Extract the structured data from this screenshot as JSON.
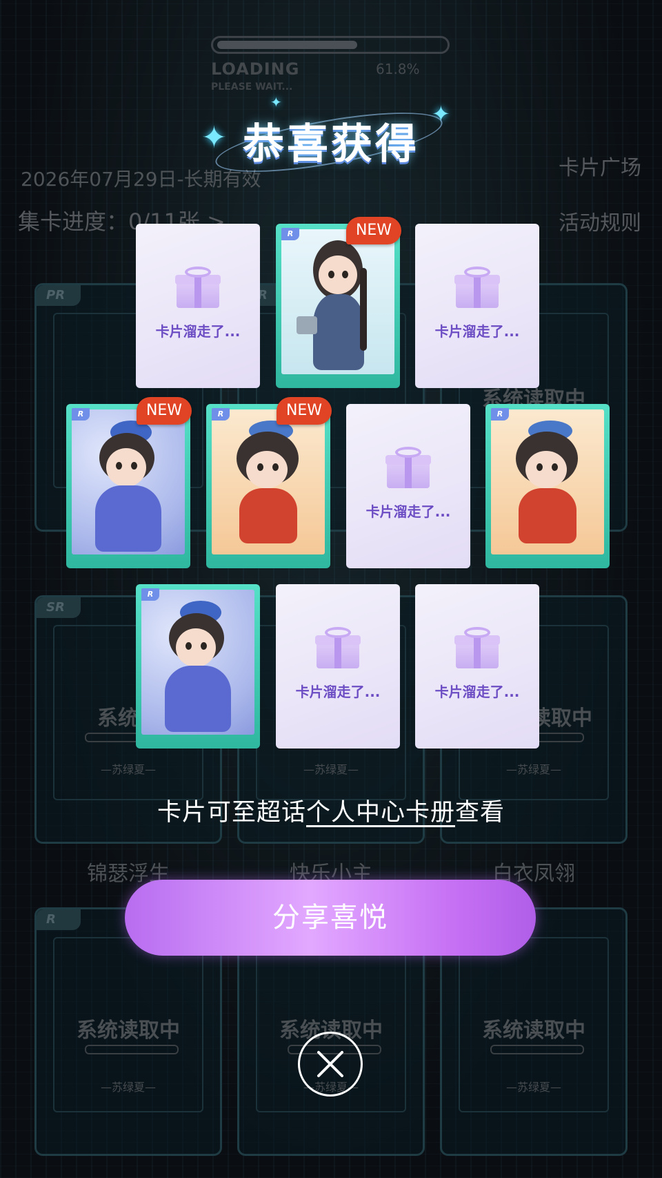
{
  "background_page": {
    "loading": {
      "label": "LOADING",
      "sub": "PLEASE WAIT...",
      "percent": "61.8%",
      "progress": 0.618
    },
    "validity": "2026年07月29日-长期有效",
    "collect_progress": "集卡进度：0/11张 >",
    "plaza_link": "卡片广场",
    "rules_link": "活动规则",
    "frames": [
      {
        "rarity": "PR",
        "title": "",
        "sub": ""
      },
      {
        "rarity": "SR",
        "title": "",
        "sub": ""
      },
      {
        "rarity": "",
        "title": "系统读取中",
        "sub": ""
      },
      {
        "rarity": "SR",
        "title": "系统读",
        "sub": "—苏绿夏—"
      },
      {
        "rarity": "",
        "title": "",
        "sub": "—苏绿夏—"
      },
      {
        "rarity": "",
        "title": "读取中",
        "sub": "—苏绿夏—"
      },
      {
        "rarity": "R",
        "title": "系统读取中",
        "sub": "—苏绿夏—"
      },
      {
        "rarity": "",
        "title": "系统读取中",
        "sub": "—苏绿夏—"
      },
      {
        "rarity": "",
        "title": "系统读取中",
        "sub": "—苏绿夏—"
      }
    ],
    "names_row2": [
      "锦瑟浮生",
      "快乐小主",
      "白衣凤翎"
    ]
  },
  "modal": {
    "title": "恭喜获得",
    "lost_text": "卡片溜走了...",
    "new_badge": "NEW",
    "rarity_tag": "R",
    "hint_prefix": "卡片可至超话",
    "hint_link": "个人中心卡册",
    "hint_suffix": "查看",
    "share_button": "分享喜悦",
    "close_icon": "close-icon"
  },
  "colors": {
    "card_border": "#3fc9b0",
    "new_badge": "#e04424",
    "share_gradient_start": "#b86cf0",
    "share_gradient_end": "#b05ee8",
    "lost_text": "#6c4dc4"
  }
}
